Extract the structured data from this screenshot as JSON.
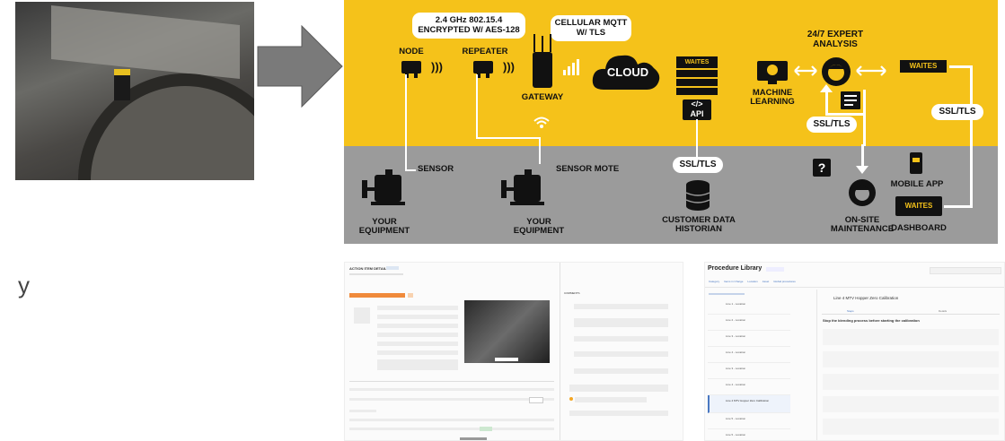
{
  "left_text_fragment": "y",
  "diagram": {
    "bubble_encryption": [
      "2.4 GHz 802.15.4",
      "ENCRYPTED W/ AES-128"
    ],
    "bubble_cellular": [
      "CELLULAR MQTT",
      "W/ TLS"
    ],
    "node_label": "NODE",
    "repeater_label": "REPEATER",
    "gateway_label": "GATEWAY",
    "cloud_label": "CLOUD",
    "waites_logo": "WAITES",
    "api_label": "API",
    "api_glyph": "</>",
    "machine_learning_label": [
      "MACHINE",
      "LEARNING"
    ],
    "expert_analysis_label": [
      "24/7 EXPERT",
      "ANALYSIS"
    ],
    "ssl_tls": "SSL/TLS",
    "sensor_label": "SENSOR",
    "sensor_mote_label": "SENSOR MOTE",
    "equipment_label": [
      "YOUR",
      "EQUIPMENT"
    ],
    "historian_label": [
      "CUSTOMER DATA",
      "HISTORIAN"
    ],
    "maintenance_label": [
      "ON-SITE",
      "MAINTENANCE"
    ],
    "mobile_app_label": "MOBILE APP",
    "dashboard_label": "DASHBOARD",
    "question_glyph": "?",
    "colors": {
      "yellow": "#f5c21a",
      "gray": "#9b9b9b",
      "black": "#111111",
      "arrow": "#7a7a7a"
    }
  },
  "screenshot_a": {
    "header": "ACTION ITEM DETAILS",
    "comments_header": "COMMENTS"
  },
  "screenshot_b": {
    "title": "Procedure Library",
    "filters": [
      "Category",
      "Items in Charge",
      "Location",
      "Asset",
      "Global procedures"
    ],
    "procedure_title": "Line 4 MTV Hopper Zero Calibration",
    "instruction": "Stop the blending process before starting the calibration",
    "tabs": [
      "Steps",
      "Details"
    ],
    "list_items": [
      "Line 1 - Location",
      "Line 2 - Location",
      "Line 3 - Location",
      "Line 4 - Location",
      "Line 4 MTV Hopper Zero Calibration",
      "Line 5 - Location",
      "Line 5 - Location"
    ]
  }
}
